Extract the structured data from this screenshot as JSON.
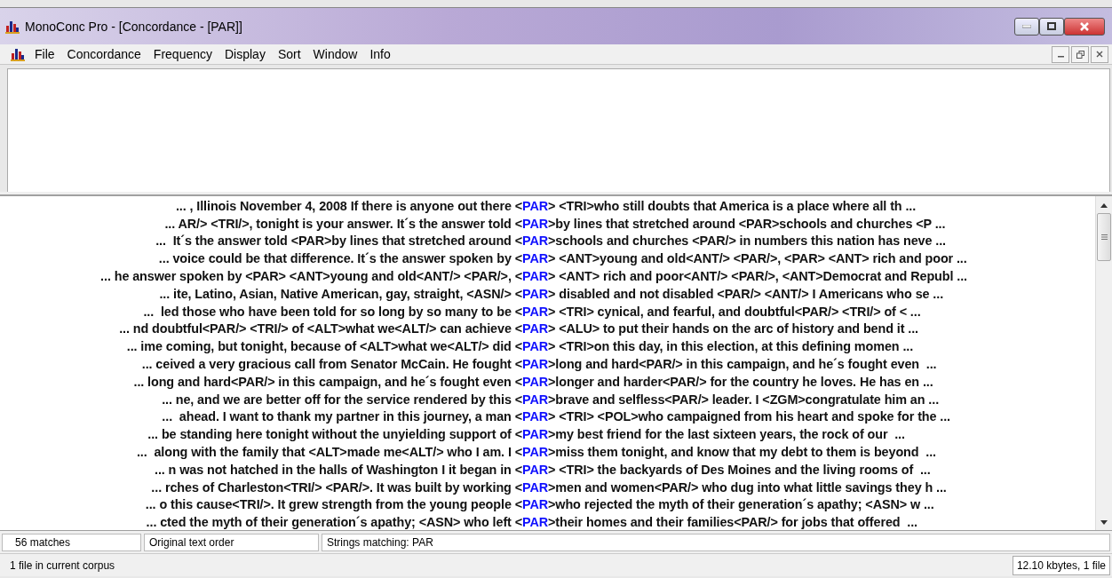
{
  "window": {
    "title": "MonoConc Pro - [Concordance - [PAR]]"
  },
  "menu": [
    "File",
    "Concordance",
    "Frequency",
    "Display",
    "Sort",
    "Window",
    "Info"
  ],
  "concordance": [
    {
      "left": "... , Illinois November 4, 2008 If there is anyone out there <",
      "keyword": "PAR",
      "right": "> <TRI>who still doubts that America is a place where all th ..."
    },
    {
      "left": "... AR/> <TRI/>, tonight is your answer. It´s the answer told <",
      "keyword": "PAR",
      "right": ">by lines that stretched around <PAR>schools and churches <P ..."
    },
    {
      "left": "...  It´s the answer told <PAR>by lines that stretched around <",
      "keyword": "PAR",
      "right": ">schools and churches <PAR/> in numbers this nation has neve ..."
    },
    {
      "left": "... voice could be that difference. It´s the answer spoken by <",
      "keyword": "PAR",
      "right": "> <ANT>young and old<ANT/> <PAR/>, <PAR> <ANT> rich and poor ..."
    },
    {
      "left": "... he answer spoken by <PAR> <ANT>young and old<ANT/> <PAR/>, <",
      "keyword": "PAR",
      "right": "> <ANT> rich and poor<ANT/> <PAR/>, <ANT>Democrat and Republ ..."
    },
    {
      "left": "... ite, Latino, Asian, Native American, gay, straight, <ASN/> <",
      "keyword": "PAR",
      "right": "> disabled and not disabled <PAR/> <ANT/> I Americans who se ..."
    },
    {
      "left": "...  led those who have been told for so long by so many to be <",
      "keyword": "PAR",
      "right": "> <TRI> cynical, and fearful, and doubtful<PAR/> <TRI/> of < ..."
    },
    {
      "left": "... nd doubtful<PAR/> <TRI/> of <ALT>what we<ALT/> can achieve <",
      "keyword": "PAR",
      "right": "> <ALU> to put their hands on the arc of history and bend it ..."
    },
    {
      "left": "... ime coming, but tonight, because of <ALT>what we<ALT/> did <",
      "keyword": "PAR",
      "right": "> <TRI>on this day, in this election, at this defining momen ..."
    },
    {
      "left": "... ceived a very gracious call from Senator McCain. He fought <",
      "keyword": "PAR",
      "right": ">long and hard<PAR/> in this campaign, and he´s fought even  ..."
    },
    {
      "left": "... long and hard<PAR/> in this campaign, and he´s fought even <",
      "keyword": "PAR",
      "right": ">longer and harder<PAR/> for the country he loves. He has en ..."
    },
    {
      "left": "... ne, and we are better off for the service rendered by this <",
      "keyword": "PAR",
      "right": ">brave and selfless<PAR/> leader. I <ZGM>congratulate him an ..."
    },
    {
      "left": "...  ahead. I want to thank my partner in this journey, a man <",
      "keyword": "PAR",
      "right": "> <TRI> <POL>who campaigned from his heart and spoke for the ..."
    },
    {
      "left": "... be standing here tonight without the unyielding support of <",
      "keyword": "PAR",
      "right": ">my best friend for the last sixteen years, the rock of our  ..."
    },
    {
      "left": "...  along with the family that <ALT>made me<ALT/> who I am. I <",
      "keyword": "PAR",
      "right": ">miss them tonight, and know that my debt to them is beyond  ..."
    },
    {
      "left": "... n was not hatched in the halls of Washington I it began in <",
      "keyword": "PAR",
      "right": "> <TRI> the backyards of Des Moines and the living rooms of  ..."
    },
    {
      "left": "... rches of Charleston<TRI/> <PAR/>. It was built by working <",
      "keyword": "PAR",
      "right": ">men and women<PAR/> who dug into what little savings they h ..."
    },
    {
      "left": "... o this cause<TRI/>. It grew strength from the young people <",
      "keyword": "PAR",
      "right": ">who rejected the myth of their generation´s apathy; <ASN> w ..."
    },
    {
      "left": "... cted the myth of their generation´s apathy; <ASN> who left <",
      "keyword": "PAR",
      "right": ">their homes and their families<PAR/> for jobs that offered  ..."
    }
  ],
  "status_bar": [
    "56 matches",
    "Original text order",
    "Strings matching: PAR"
  ],
  "corpus_bar": {
    "left": "1 file in current corpus",
    "right": "12.10 kbytes, 1 file"
  }
}
